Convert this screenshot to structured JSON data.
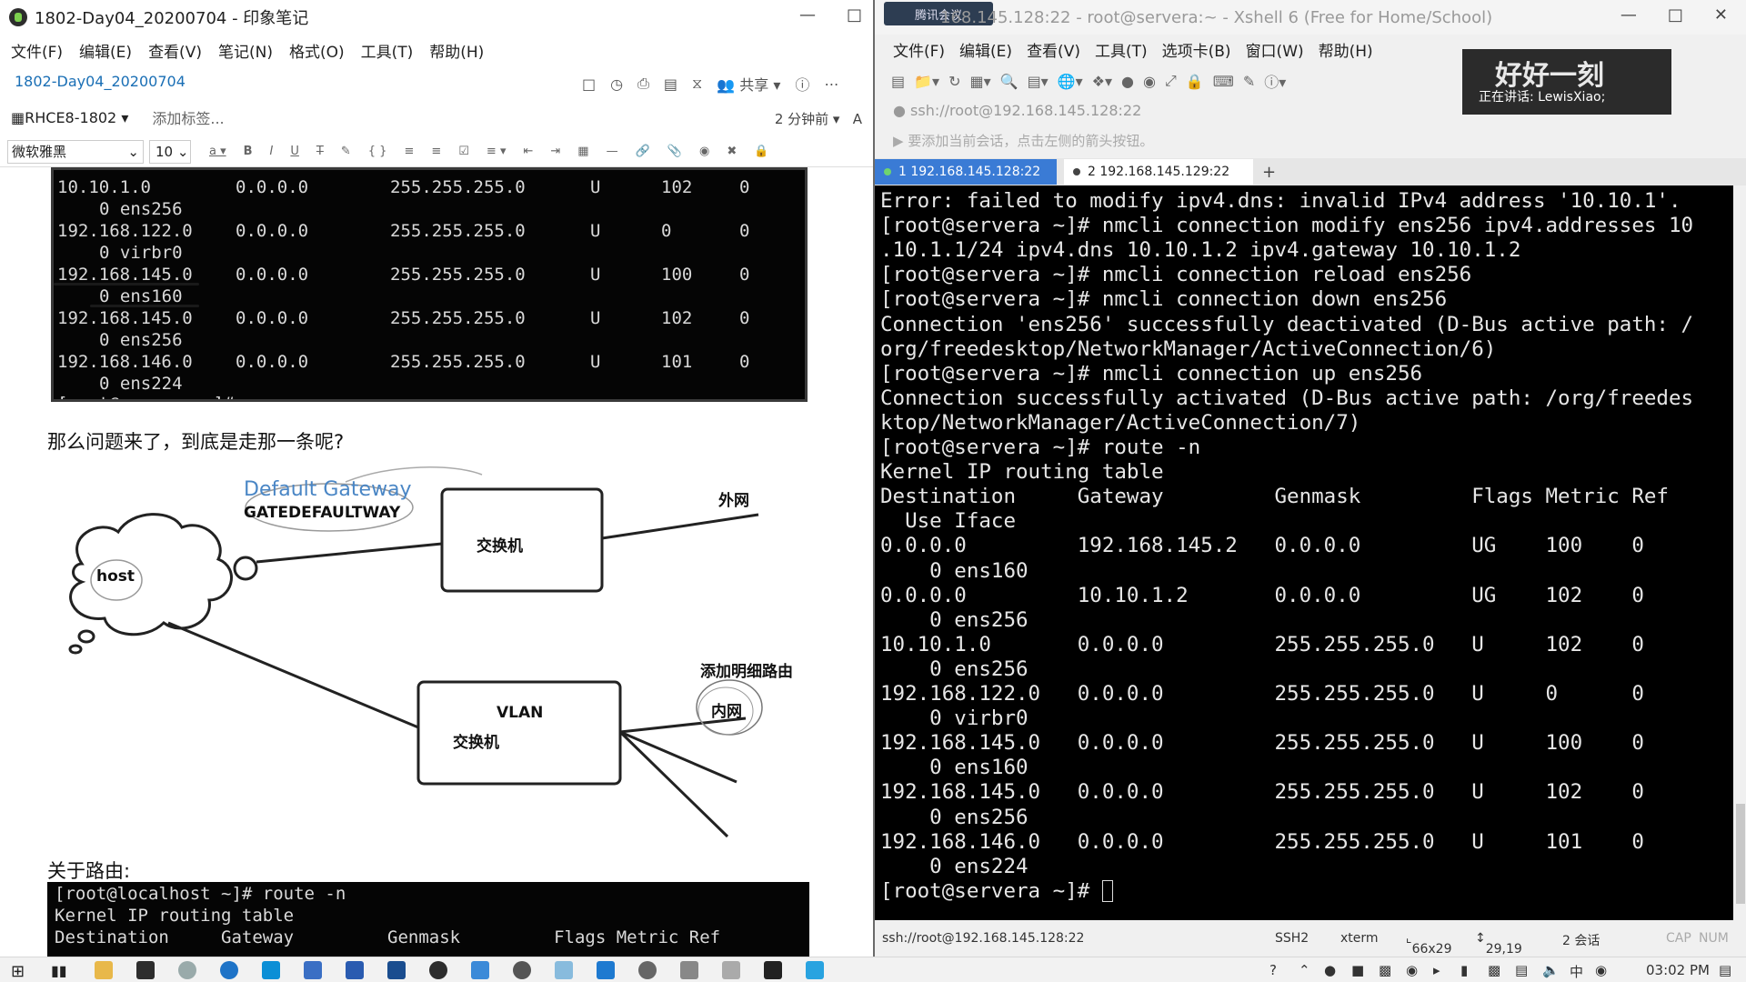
{
  "left_window": {
    "title": "1802-Day04_20200704 - 印象笔记",
    "menu": [
      "文件(F)",
      "编辑(E)",
      "查看(V)",
      "笔记(N)",
      "格式(O)",
      "工具(T)",
      "帮助(H)"
    ],
    "note_title": "1802-Day04_20200704",
    "share_label": "共享",
    "notebook": "RHCE8-1802",
    "add_tag": "添加标签...",
    "modified": "2 分钟前",
    "font_name": "微软雅黑",
    "font_size": "10",
    "route_rows_top": [
      [
        "10.10.1.0",
        "0.0.0.0",
        "255.255.255.0",
        "U",
        "102",
        "0"
      ],
      [
        "",
        "",
        "",
        "",
        "",
        ""
      ],
      [
        "192.168.122.0",
        "0.0.0.0",
        "255.255.255.0",
        "U",
        "0",
        "0"
      ],
      [
        "",
        "",
        "",
        "",
        "",
        ""
      ],
      [
        "192.168.145.0",
        "0.0.0.0",
        "255.255.255.0",
        "U",
        "100",
        "0"
      ],
      [
        "",
        "",
        "",
        "",
        "",
        ""
      ],
      [
        "192.168.145.0",
        "0.0.0.0",
        "255.255.255.0",
        "U",
        "102",
        "0"
      ],
      [
        "",
        "",
        "",
        "",
        "",
        ""
      ],
      [
        "192.168.146.0",
        "0.0.0.0",
        "255.255.255.0",
        "U",
        "101",
        "0"
      ]
    ],
    "iface_rows_top": [
      "0 ens256",
      "0 virbr0",
      "0 ens160",
      "0 ens256",
      "0 ens224"
    ],
    "prompt_fragment": "[root@servera ~]# ",
    "question": "那么问题来了，到底是走那一条呢?",
    "diagram": {
      "default_gateway": "Default Gateway",
      "gate_default": "GATEDEFAULTWAY",
      "switch": "交换机",
      "wan": "外网",
      "host": "host",
      "vlan": "VLAN",
      "vlan_switch": "交换机",
      "add_route": "添加明细路由",
      "lan": "内网"
    },
    "about_routing": "关于路由:",
    "bottom_term": [
      "[root@localhost ~]# route -n",
      "Kernel IP routing table",
      "Destination     Gateway         Genmask         Flags Metric Ref"
    ]
  },
  "right_window": {
    "title": "168.145.128:22 - root@servera:~ - Xshell 6 (Free for Home/School)",
    "meeting": "腾讯会议",
    "menu": [
      "文件(F)",
      "编辑(E)",
      "查看(V)",
      "工具(T)",
      "选项卡(B)",
      "窗口(W)",
      "帮助(H)"
    ],
    "address": "ssh://root@192.168.145.128:22",
    "hint": "要添加当前会话，点击左侧的箭头按钮。",
    "ad_big": "好好一刻",
    "ad_small": "正在讲话: LewisXiao;",
    "tabs": [
      {
        "label": "1 192.168.145.128:22",
        "active": true
      },
      {
        "label": "2 192.168.145.129:22",
        "active": false
      }
    ],
    "terminal_lines": [
      "Error: failed to modify ipv4.dns: invalid IPv4 address '10.10.1'.",
      "[root@servera ~]# nmcli connection modify ens256 ipv4.addresses 10",
      ".10.1.1/24 ipv4.dns 10.10.1.2 ipv4.gateway 10.10.1.2",
      "[root@servera ~]# nmcli connection reload ens256",
      "[root@servera ~]# nmcli connection down ens256",
      "Connection 'ens256' successfully deactivated (D-Bus active path: /",
      "org/freedesktop/NetworkManager/ActiveConnection/6)",
      "[root@servera ~]# nmcli connection up ens256",
      "Connection successfully activated (D-Bus active path: /org/freedes",
      "ktop/NetworkManager/ActiveConnection/7)",
      "[root@servera ~]# route -n",
      "Kernel IP routing table",
      "Destination     Gateway         Genmask         Flags Metric Ref",
      "  Use Iface",
      "0.0.0.0         192.168.145.2   0.0.0.0         UG    100    0",
      "    0 ens160",
      "0.0.0.0         10.10.1.2       0.0.0.0         UG    102    0",
      "    0 ens256",
      "10.10.1.0       0.0.0.0         255.255.255.0   U     102    0",
      "    0 ens256",
      "192.168.122.0   0.0.0.0         255.255.255.0   U     0      0",
      "    0 virbr0",
      "192.168.145.0   0.0.0.0         255.255.255.0   U     100    0",
      "    0 ens160",
      "192.168.145.0   0.0.0.0         255.255.255.0   U     102    0",
      "    0 ens256",
      "192.168.146.0   0.0.0.0         255.255.255.0   U     101    0",
      "    0 ens224",
      "[root@servera ~]# "
    ],
    "status": {
      "session": "ssh://root@192.168.145.128:22",
      "protocol": "SSH2",
      "term": "xterm",
      "size": "66x29",
      "cursor": "29,19",
      "sessions": "2 会话",
      "cap": "CAP",
      "num": "NUM"
    }
  },
  "taskbar": {
    "time": "03:02 PM"
  }
}
